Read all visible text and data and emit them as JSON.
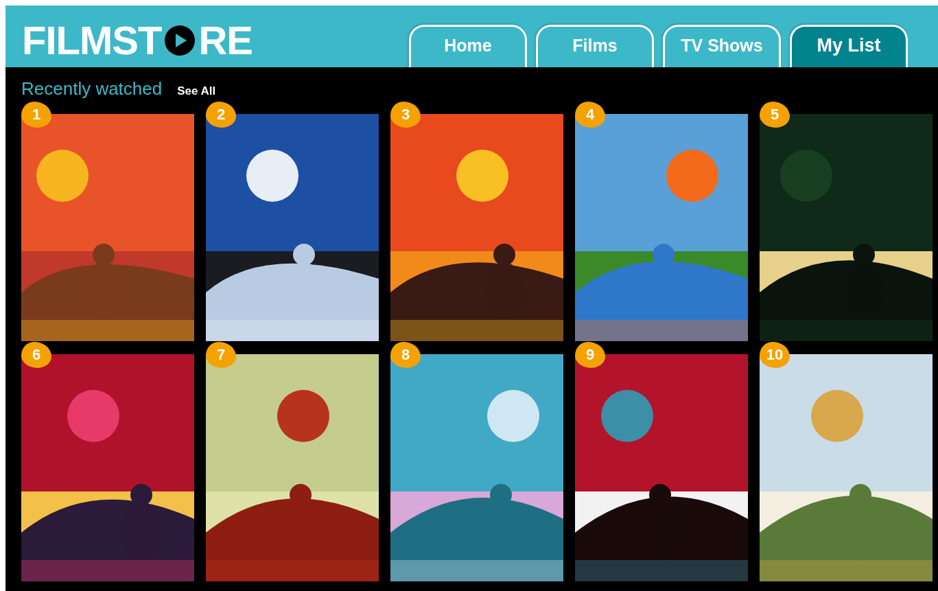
{
  "logo": {
    "before_icon": "FILMST",
    "after_icon": "RE"
  },
  "tabs": [
    {
      "label": "Home",
      "selected": false
    },
    {
      "label": "Films",
      "selected": false
    },
    {
      "label": "TV Shows",
      "selected": false
    },
    {
      "label": "My List",
      "selected": true
    }
  ],
  "section": {
    "title": "Recently watched",
    "link": "See All"
  },
  "films": [
    {
      "rank": "1",
      "kind": "picture"
    },
    {
      "rank": "2",
      "kind": "picture"
    },
    {
      "rank": "3",
      "kind": "picture"
    },
    {
      "rank": "4",
      "kind": "picture"
    },
    {
      "rank": "5",
      "kind": "picture"
    },
    {
      "rank": "6",
      "kind": "picture"
    },
    {
      "rank": "7",
      "kind": "picture"
    },
    {
      "rank": "8",
      "kind": "picture"
    },
    {
      "rank": "9",
      "kind": "picture"
    },
    {
      "rank": "10",
      "kind": "picture"
    }
  ]
}
